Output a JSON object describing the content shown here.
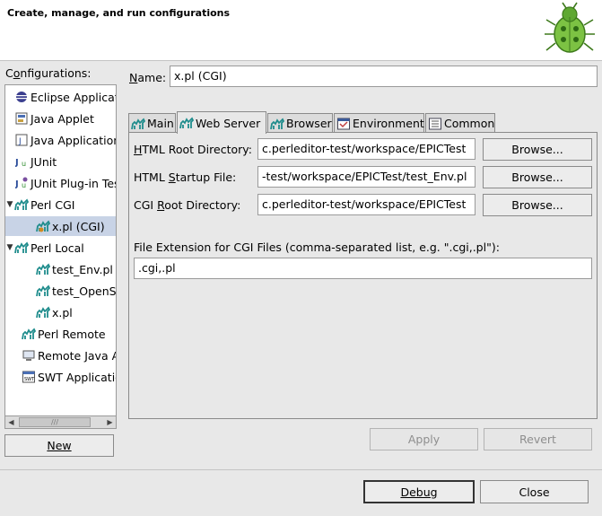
{
  "banner": {
    "title": "Create, manage, and run configurations"
  },
  "configurations": {
    "label": "Configurations:",
    "items": [
      {
        "label": "Eclipse Application",
        "icon": "eclipse-icon",
        "level": 0
      },
      {
        "label": "Java Applet",
        "icon": "java-applet-icon",
        "level": 0
      },
      {
        "label": "Java Application",
        "icon": "java-application-icon",
        "level": 0
      },
      {
        "label": "JUnit",
        "icon": "junit-icon",
        "level": 0
      },
      {
        "label": "JUnit Plug-in Test",
        "icon": "junit-plugin-icon",
        "level": 0
      },
      {
        "label": "Perl CGI",
        "icon": "perl-camel-icon",
        "level": 0,
        "expanded": true
      },
      {
        "label": "x.pl (CGI)",
        "icon": "perl-camel-icon",
        "level": 1,
        "selected": true
      },
      {
        "label": "Perl Local",
        "icon": "perl-camel-icon",
        "level": 0,
        "expanded": true
      },
      {
        "label": "test_Env.pl",
        "icon": "perl-camel-icon",
        "level": 1
      },
      {
        "label": "test_OpenSocket.pl",
        "icon": "perl-camel-icon",
        "level": 1
      },
      {
        "label": "x.pl",
        "icon": "perl-camel-icon",
        "level": 1
      },
      {
        "label": "Perl Remote",
        "icon": "perl-camel-icon",
        "level": 0
      },
      {
        "label": "Remote Java Application",
        "icon": "remote-java-icon",
        "level": 0
      },
      {
        "label": "SWT Application",
        "icon": "swt-icon",
        "level": 0
      }
    ],
    "new_button": "New"
  },
  "name": {
    "label": "Name:",
    "value": "x.pl (CGI)"
  },
  "tabs": [
    {
      "label": "Main",
      "icon": "perl-camel-icon"
    },
    {
      "label": "Web Server",
      "icon": "perl-camel-icon",
      "active": true
    },
    {
      "label": "Browser",
      "icon": "perl-camel-icon"
    },
    {
      "label": "Environment",
      "icon": "environment-icon"
    },
    {
      "label": "Common",
      "icon": "common-icon"
    }
  ],
  "web_server": {
    "html_root": {
      "label": "HTML Root Directory:",
      "value": "c.perleditor-test/workspace/EPICTest",
      "browse": "Browse..."
    },
    "html_startup": {
      "label": "HTML Startup File:",
      "value": "-test/workspace/EPICTest/test_Env.pl",
      "browse": "Browse..."
    },
    "cgi_root": {
      "label": "CGI Root Directory:",
      "value": "c.perleditor-test/workspace/EPICTest",
      "browse": "Browse..."
    },
    "extension": {
      "label": "File Extension for CGI Files (comma-separated list, e.g. \".cgi,.pl\"):",
      "value": ".cgi,.pl"
    }
  },
  "actions": {
    "apply": "Apply",
    "revert": "Revert"
  },
  "dialog": {
    "debug": "Debug",
    "close": "Close"
  },
  "colors": {
    "selection": "#c8d3e6",
    "camel": "#1e8c8c"
  }
}
